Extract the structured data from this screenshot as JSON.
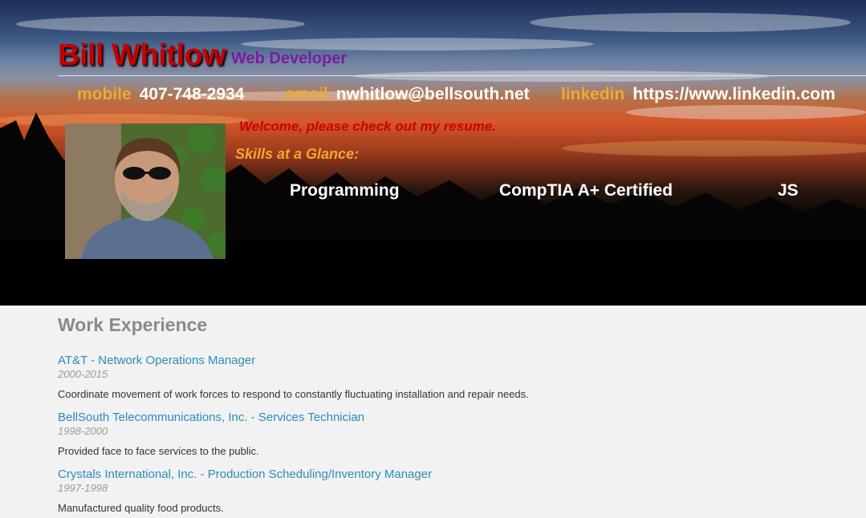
{
  "header": {
    "name": "Bill Whitlow",
    "role": "Web Developer",
    "contacts": [
      {
        "label": "mobile",
        "value": "407-748-2934"
      },
      {
        "label": "email",
        "value": "nwhitlow@bellsouth.net"
      },
      {
        "label": "linkedin",
        "value": "https://www.linkedin.com"
      }
    ],
    "welcome": "Welcome, please check out my resume.",
    "skills_title": "Skills at a Glance:",
    "skills": [
      "Programming",
      "CompTIA A+ Certified",
      "JS"
    ]
  },
  "work": {
    "title": "Work Experience",
    "jobs": [
      {
        "title": "AT&T - Network Operations Manager",
        "dates": "2000-2015",
        "description": "Coordinate movement of work forces to respond to constantly fluctuating installation and repair needs."
      },
      {
        "title": "BellSouth Telecommunications, Inc. - Services Technician",
        "dates": "1998-2000",
        "description": "Provided face to face services to the public."
      },
      {
        "title": "Crystals International, Inc. - Production Scheduling/Inventory Manager",
        "dates": "1997-1998",
        "description": "Manufactured quality food products."
      }
    ]
  },
  "colors": {
    "name": "#c40000",
    "role": "#7b1c9e",
    "label": "#f0a830",
    "link": "#2a8bbf",
    "section_title": "#8a8a8a"
  }
}
